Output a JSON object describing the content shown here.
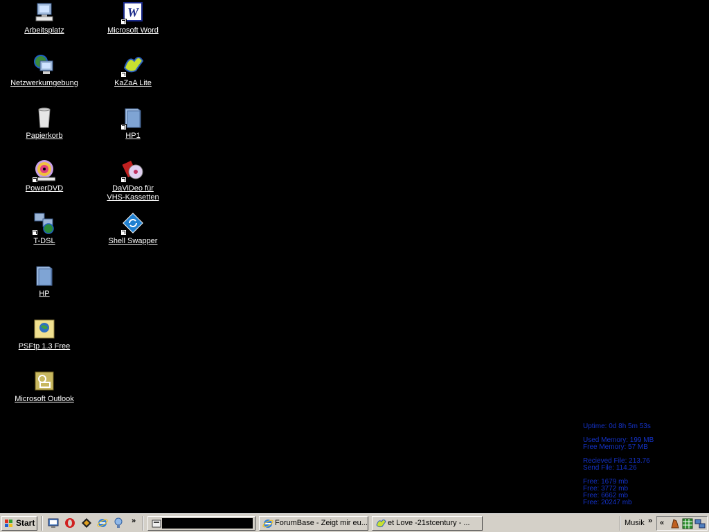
{
  "desktop": {
    "icons": [
      {
        "label": "Arbeitsplatz",
        "icon": "my-computer-icon"
      },
      {
        "label": "Netzwerkumgebung",
        "icon": "network-places-icon"
      },
      {
        "label": "Papierkorb",
        "icon": "recycle-bin-icon"
      },
      {
        "label": "PowerDVD",
        "icon": "powerdvd-icon"
      },
      {
        "label": "T-DSL",
        "icon": "network-connection-icon"
      },
      {
        "label": "HP",
        "icon": "folder-icon"
      },
      {
        "label": "PSFtp 1.3 Free",
        "icon": "psftp-icon"
      },
      {
        "label": "Microsoft Outlook",
        "icon": "outlook-icon"
      },
      {
        "label": "Microsoft Word",
        "icon": "word-icon"
      },
      {
        "label": "KaZaA Lite",
        "icon": "kazaa-icon"
      },
      {
        "label": "HP1",
        "icon": "folder-icon"
      },
      {
        "label": "DaViDeo für\nVHS-Kassetten",
        "icon": "davideo-icon"
      },
      {
        "label": "Shell Swapper",
        "icon": "shell-swapper-icon"
      }
    ]
  },
  "sysinfo": {
    "uptime": "Uptime: 0d 8h 5m 53s",
    "used_memory": "Used Memory: 199 MB",
    "free_memory": "Free Memory: 57 MB",
    "received": "Recieved File: 213.76",
    "sent": "Send File: 114.26",
    "drives": [
      "Free: 1679 mb",
      "Free: 3772 mb",
      "Free: 6662 mb",
      "Free: 20247 mb"
    ],
    "color": "#1432c8"
  },
  "taskbar": {
    "start_label": "Start",
    "quick_launch": [
      "desktop-icon",
      "opera-icon",
      "winamp-icon",
      "internet-explorer-icon",
      "media-icon"
    ],
    "chevron": "»",
    "tasks": [
      {
        "label": "",
        "icon": "app-icon"
      },
      {
        "label": "ForumBase - Zeigt mir eu...",
        "icon": "internet-explorer-icon"
      },
      {
        "label": "et Love -21stcentury - ...",
        "icon": "kazaa-icon"
      }
    ],
    "toolbar_label": "Musik",
    "tray_chevron": "«",
    "tray_icons": [
      "tray-app-icon",
      "tray-grid-icon",
      "tray-network-icon"
    ],
    "background": "#d4d0c8"
  }
}
